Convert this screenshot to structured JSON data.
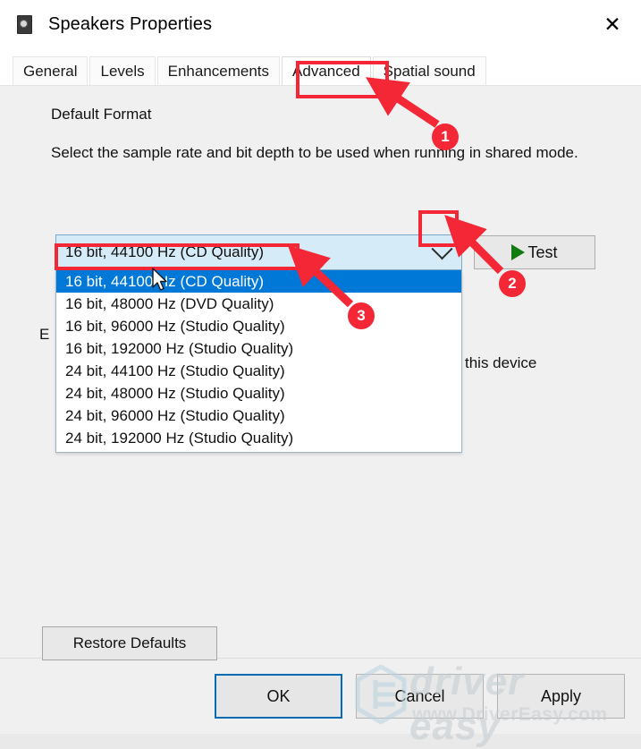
{
  "window": {
    "title": "Speakers Properties",
    "icon": "speaker-icon",
    "close_label": "✕"
  },
  "tabs": [
    {
      "label": "General",
      "selected": false
    },
    {
      "label": "Levels",
      "selected": false
    },
    {
      "label": "Enhancements",
      "selected": false
    },
    {
      "label": "Advanced",
      "selected": true
    },
    {
      "label": "Spatial sound",
      "selected": false
    }
  ],
  "advanced": {
    "group_title": "Default Format",
    "description": "Select the sample rate and bit depth to be used when running in shared mode.",
    "combo": {
      "value": "16 bit, 44100 Hz (CD Quality)",
      "arrow_icon": "chevron-down-icon",
      "expanded": true,
      "options": [
        "16 bit, 44100 Hz (CD Quality)",
        "16 bit, 48000 Hz (DVD Quality)",
        "16 bit, 96000 Hz (Studio Quality)",
        "16 bit, 192000 Hz (Studio Quality)",
        "24 bit, 44100 Hz (Studio Quality)",
        "24 bit, 48000 Hz (Studio Quality)",
        "24 bit, 96000 Hz (Studio Quality)",
        "24 bit, 192000 Hz (Studio Quality)"
      ],
      "selected_index": 0
    },
    "test_button": {
      "label": "Test",
      "icon": "play-icon"
    },
    "obscured_left_text": "E",
    "obscured_right_text": "this device",
    "restore_defaults_label": "Restore Defaults"
  },
  "footer": {
    "ok_label": "OK",
    "cancel_label": "Cancel",
    "apply_label": "Apply"
  },
  "watermark": {
    "brand": "driver easy",
    "url": "www.DriverEasy.com"
  },
  "annotations": {
    "accent_color": "#f32735",
    "badges": [
      {
        "number": "1",
        "target": "advanced-tab"
      },
      {
        "number": "2",
        "target": "combo-dropdown-arrow"
      },
      {
        "number": "3",
        "target": "selected-option"
      }
    ]
  },
  "colors": {
    "selection_blue": "#0078d7",
    "combo_fill": "#d6ebf8",
    "dialog_bg": "#f0f0f0",
    "play_green": "#107c10",
    "annotation_red": "#f32735",
    "default_button_border": "#0a6bb5"
  }
}
